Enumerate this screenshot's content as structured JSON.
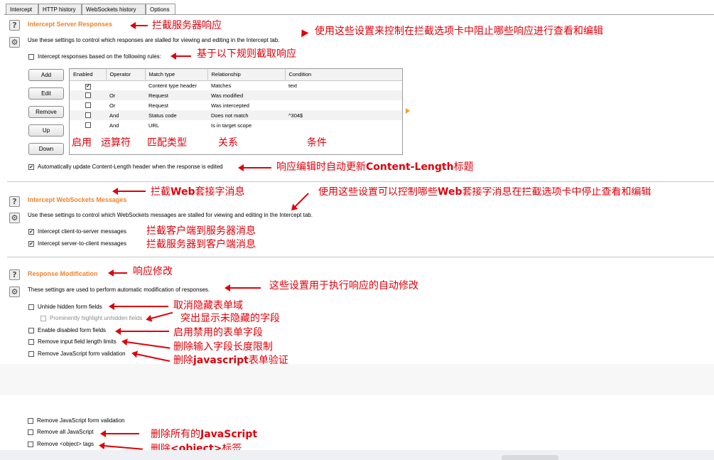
{
  "tabs": [
    "Intercept",
    "HTTP history",
    "WebSockets history",
    "Options"
  ],
  "server_responses": {
    "title": "Intercept Server Responses",
    "description": "Use these settings to control which responses are stalled for viewing and editing in the Intercept tab.",
    "rule_checkbox_label": "Intercept responses based on the following rules:",
    "buttons": [
      "Add",
      "Edit",
      "Remove",
      "Up",
      "Down"
    ],
    "table": {
      "headers": [
        "Enabled",
        "Operator",
        "Match type",
        "Relationship",
        "Condition"
      ],
      "rows": [
        {
          "enabled": true,
          "operator": "",
          "match_type": "Content type header",
          "relationship": "Matches",
          "condition": "text"
        },
        {
          "enabled": false,
          "operator": "Or",
          "match_type": "Request",
          "relationship": "Was modified",
          "condition": ""
        },
        {
          "enabled": false,
          "operator": "Or",
          "match_type": "Request",
          "relationship": "Was intercepted",
          "condition": ""
        },
        {
          "enabled": false,
          "operator": "And",
          "match_type": "Status code",
          "relationship": "Does not match",
          "condition": "^304$"
        },
        {
          "enabled": false,
          "operator": "And",
          "match_type": "URL",
          "relationship": "Is in target scope",
          "condition": ""
        }
      ]
    },
    "auto_update_label": "Automatically update Content-Length header when the response is edited"
  },
  "websockets": {
    "title": "Intercept WebSockets Messages",
    "description": "Use these settings to control which WebSockets messages are stalled for viewing and editing in the Intercept tab.",
    "client_to_server_label": "Intercept client-to-server messages",
    "server_to_client_label": "Intercept server-to-client messages"
  },
  "response_modification": {
    "title": "Response Modification",
    "description": "These settings are used to perform automatic modification of responses.",
    "options": [
      "Unhide hidden form fields",
      "Prominently highlight unhidden fields",
      "Enable disabled form fields",
      "Remove input field length limits",
      "Remove JavaScript form validation"
    ]
  },
  "lower_options": [
    "Remove JavaScript form validation",
    "Remove all JavaScript",
    "Remove <object> tags"
  ],
  "annotations": {
    "server_title": "拦截服务器响应",
    "server_desc": "使用这些设置来控制在拦截选项卡中阻止哪些响应进行查看和编辑",
    "rules": "基于以下规则截取响应",
    "col_enabled": "启用",
    "col_operator": "运算符",
    "col_match": "匹配类型",
    "col_relationship": "关系",
    "col_condition": "条件",
    "auto_update_pre": "响应编辑时自动更新",
    "auto_update_bold": "Content-Length",
    "auto_update_post": "标题",
    "ws_title_pre": "拦截",
    "ws_title_bold": "Web",
    "ws_title_post": "套接字消息",
    "ws_desc_pre": "使用这些设置可以控制哪些",
    "ws_desc_bold": "Web",
    "ws_desc_post": "套接字消息在拦截选项卡中停止查看和编辑",
    "ws_c2s": "拦截客户端到服务器消息",
    "ws_s2c": "拦截服务器到客户端消息",
    "mod_title": "响应修改",
    "mod_desc": "这些设置用于执行响应的自动修改",
    "unhide": "取消隐藏表单域",
    "highlight": "突出显示未隐藏的字段",
    "enable_disabled": "启用禁用的表单字段",
    "remove_limits": "删除输入字段长度限制",
    "remove_validation_pre": "删除",
    "remove_validation_bold": "javascript",
    "remove_validation_post": "表单验证",
    "remove_all_js_pre": "删除所有的",
    "remove_all_js_bold": "JavaScript",
    "remove_object_pre": "删除",
    "remove_object_bold": "<object>",
    "remove_object_post": "标签"
  },
  "colors": {
    "accent": "#f0822a",
    "annotation": "#e0000a"
  }
}
